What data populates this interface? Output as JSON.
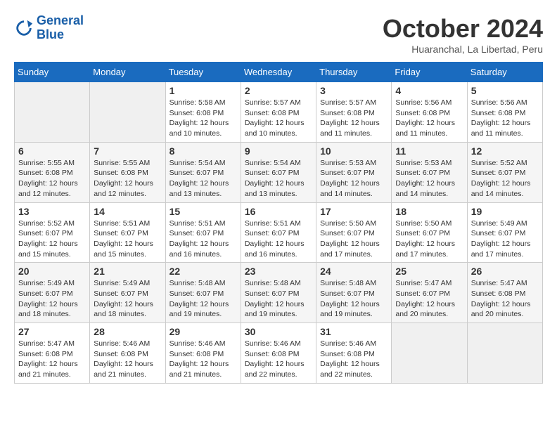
{
  "logo": {
    "line1": "General",
    "line2": "Blue"
  },
  "title": "October 2024",
  "subtitle": "Huaranchal, La Libertad, Peru",
  "days_of_week": [
    "Sunday",
    "Monday",
    "Tuesday",
    "Wednesday",
    "Thursday",
    "Friday",
    "Saturday"
  ],
  "weeks": [
    [
      {
        "day": "",
        "info": ""
      },
      {
        "day": "",
        "info": ""
      },
      {
        "day": "1",
        "info": "Sunrise: 5:58 AM\nSunset: 6:08 PM\nDaylight: 12 hours\nand 10 minutes."
      },
      {
        "day": "2",
        "info": "Sunrise: 5:57 AM\nSunset: 6:08 PM\nDaylight: 12 hours\nand 10 minutes."
      },
      {
        "day": "3",
        "info": "Sunrise: 5:57 AM\nSunset: 6:08 PM\nDaylight: 12 hours\nand 11 minutes."
      },
      {
        "day": "4",
        "info": "Sunrise: 5:56 AM\nSunset: 6:08 PM\nDaylight: 12 hours\nand 11 minutes."
      },
      {
        "day": "5",
        "info": "Sunrise: 5:56 AM\nSunset: 6:08 PM\nDaylight: 12 hours\nand 11 minutes."
      }
    ],
    [
      {
        "day": "6",
        "info": "Sunrise: 5:55 AM\nSunset: 6:08 PM\nDaylight: 12 hours\nand 12 minutes."
      },
      {
        "day": "7",
        "info": "Sunrise: 5:55 AM\nSunset: 6:08 PM\nDaylight: 12 hours\nand 12 minutes."
      },
      {
        "day": "8",
        "info": "Sunrise: 5:54 AM\nSunset: 6:07 PM\nDaylight: 12 hours\nand 13 minutes."
      },
      {
        "day": "9",
        "info": "Sunrise: 5:54 AM\nSunset: 6:07 PM\nDaylight: 12 hours\nand 13 minutes."
      },
      {
        "day": "10",
        "info": "Sunrise: 5:53 AM\nSunset: 6:07 PM\nDaylight: 12 hours\nand 14 minutes."
      },
      {
        "day": "11",
        "info": "Sunrise: 5:53 AM\nSunset: 6:07 PM\nDaylight: 12 hours\nand 14 minutes."
      },
      {
        "day": "12",
        "info": "Sunrise: 5:52 AM\nSunset: 6:07 PM\nDaylight: 12 hours\nand 14 minutes."
      }
    ],
    [
      {
        "day": "13",
        "info": "Sunrise: 5:52 AM\nSunset: 6:07 PM\nDaylight: 12 hours\nand 15 minutes."
      },
      {
        "day": "14",
        "info": "Sunrise: 5:51 AM\nSunset: 6:07 PM\nDaylight: 12 hours\nand 15 minutes."
      },
      {
        "day": "15",
        "info": "Sunrise: 5:51 AM\nSunset: 6:07 PM\nDaylight: 12 hours\nand 16 minutes."
      },
      {
        "day": "16",
        "info": "Sunrise: 5:51 AM\nSunset: 6:07 PM\nDaylight: 12 hours\nand 16 minutes."
      },
      {
        "day": "17",
        "info": "Sunrise: 5:50 AM\nSunset: 6:07 PM\nDaylight: 12 hours\nand 17 minutes."
      },
      {
        "day": "18",
        "info": "Sunrise: 5:50 AM\nSunset: 6:07 PM\nDaylight: 12 hours\nand 17 minutes."
      },
      {
        "day": "19",
        "info": "Sunrise: 5:49 AM\nSunset: 6:07 PM\nDaylight: 12 hours\nand 17 minutes."
      }
    ],
    [
      {
        "day": "20",
        "info": "Sunrise: 5:49 AM\nSunset: 6:07 PM\nDaylight: 12 hours\nand 18 minutes."
      },
      {
        "day": "21",
        "info": "Sunrise: 5:49 AM\nSunset: 6:07 PM\nDaylight: 12 hours\nand 18 minutes."
      },
      {
        "day": "22",
        "info": "Sunrise: 5:48 AM\nSunset: 6:07 PM\nDaylight: 12 hours\nand 19 minutes."
      },
      {
        "day": "23",
        "info": "Sunrise: 5:48 AM\nSunset: 6:07 PM\nDaylight: 12 hours\nand 19 minutes."
      },
      {
        "day": "24",
        "info": "Sunrise: 5:48 AM\nSunset: 6:07 PM\nDaylight: 12 hours\nand 19 minutes."
      },
      {
        "day": "25",
        "info": "Sunrise: 5:47 AM\nSunset: 6:07 PM\nDaylight: 12 hours\nand 20 minutes."
      },
      {
        "day": "26",
        "info": "Sunrise: 5:47 AM\nSunset: 6:08 PM\nDaylight: 12 hours\nand 20 minutes."
      }
    ],
    [
      {
        "day": "27",
        "info": "Sunrise: 5:47 AM\nSunset: 6:08 PM\nDaylight: 12 hours\nand 21 minutes."
      },
      {
        "day": "28",
        "info": "Sunrise: 5:46 AM\nSunset: 6:08 PM\nDaylight: 12 hours\nand 21 minutes."
      },
      {
        "day": "29",
        "info": "Sunrise: 5:46 AM\nSunset: 6:08 PM\nDaylight: 12 hours\nand 21 minutes."
      },
      {
        "day": "30",
        "info": "Sunrise: 5:46 AM\nSunset: 6:08 PM\nDaylight: 12 hours\nand 22 minutes."
      },
      {
        "day": "31",
        "info": "Sunrise: 5:46 AM\nSunset: 6:08 PM\nDaylight: 12 hours\nand 22 minutes."
      },
      {
        "day": "",
        "info": ""
      },
      {
        "day": "",
        "info": ""
      }
    ]
  ]
}
